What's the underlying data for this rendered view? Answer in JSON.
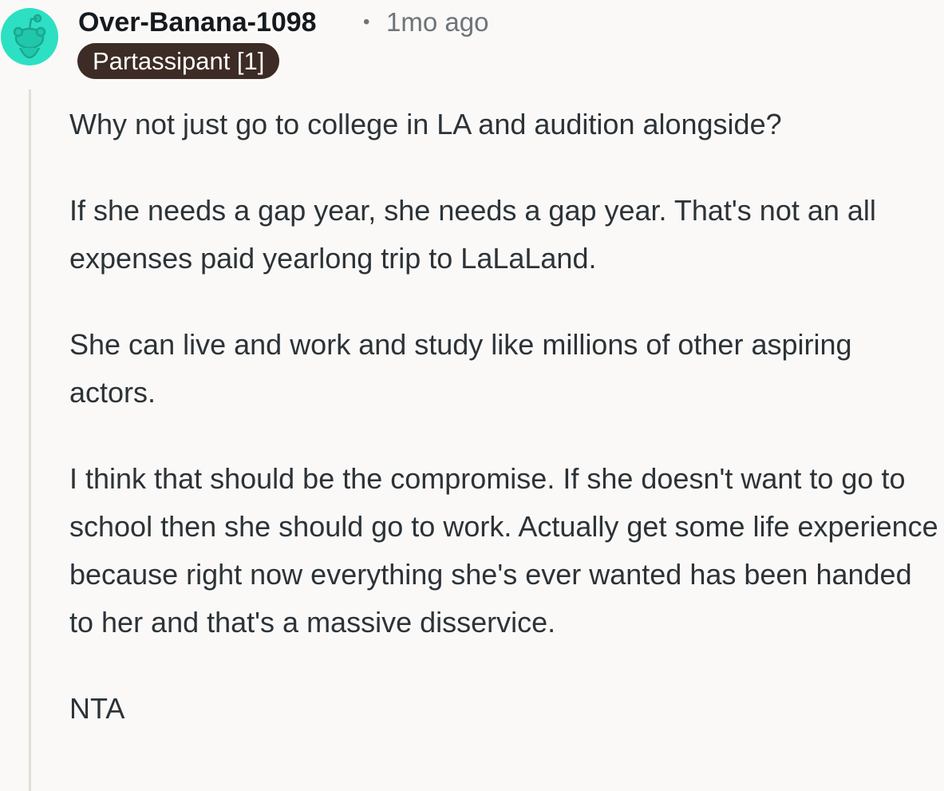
{
  "comment": {
    "author": "Over-Banana-1098",
    "separator": "•",
    "timestamp": "1mo ago",
    "flair": "Partassipant [1]",
    "avatar_icon": "snoo-avatar-icon",
    "avatar_color": "#2de0c4",
    "flair_color": "#3d2b25",
    "paragraphs": [
      "Why not just go to college in LA and audition alongside?",
      "If she needs a gap year, she needs a gap year. That's not an all expenses paid yearlong trip to LaLaLand.",
      "She can live and work and study like millions of other aspiring actors.",
      "I think that should be the compromise. If she doesn't want to go to school then she should go to work. Actually get some life experience because right now everything she's ever wanted has been handed to her and that's a massive disservice.",
      "NTA"
    ]
  }
}
